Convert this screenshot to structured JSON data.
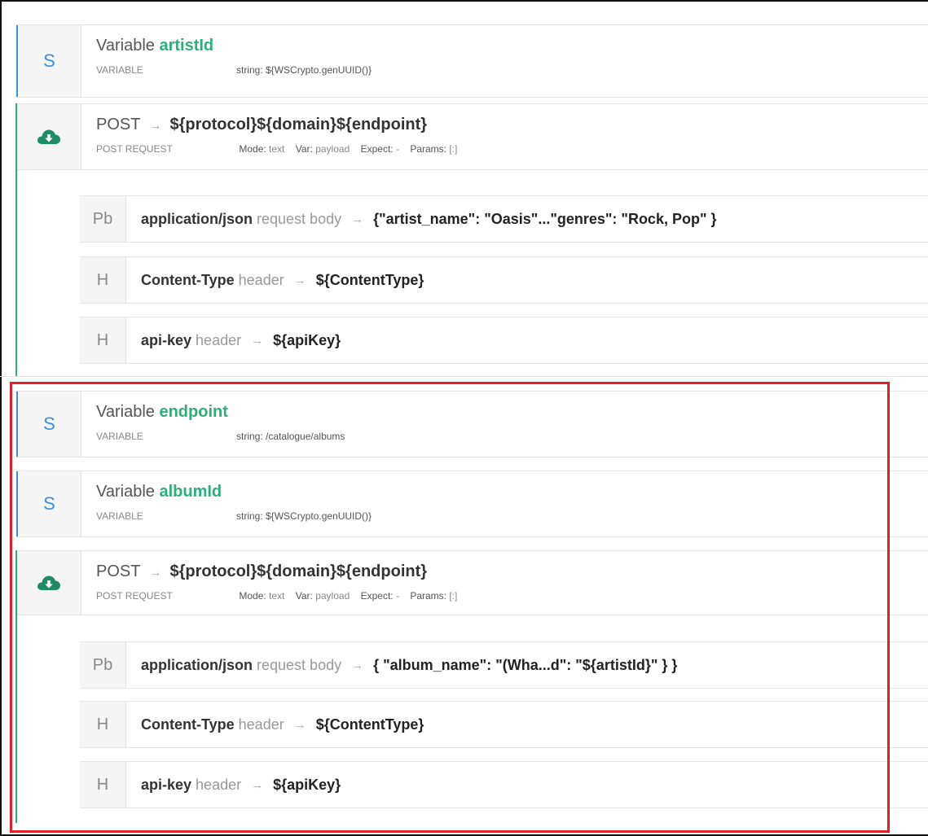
{
  "steps": [
    {
      "badge": "S",
      "title_prefix": "Variable",
      "name": "artistId",
      "kind": "VARIABLE",
      "value": "string: ${WSCrypto.genUUID()}"
    },
    {
      "method": "POST",
      "arrow": "→",
      "url": "${protocol}${domain}${endpoint}",
      "kind": "POST REQUEST",
      "mode_label": "Mode:",
      "mode_value": "text",
      "var_label": "Var:",
      "var_value": "payload",
      "expect_label": "Expect:",
      "expect_value": "-",
      "params_label": "Params:",
      "params_value": "[:]",
      "children": [
        {
          "badge": "Pb",
          "key": "application/json",
          "type": "request body",
          "arrow": "→",
          "value": "{\"artist_name\": \"Oasis\"...\"genres\": \"Rock, Pop\" }"
        },
        {
          "badge": "H",
          "key": "Content-Type",
          "type": "header",
          "arrow": "→",
          "value": "${ContentType}"
        },
        {
          "badge": "H",
          "key": "api-key",
          "type": "header",
          "arrow": "→",
          "value": "${apiKey}"
        }
      ]
    },
    {
      "badge": "S",
      "title_prefix": "Variable",
      "name": "endpoint",
      "kind": "VARIABLE",
      "value": "string: /catalogue/albums"
    },
    {
      "badge": "S",
      "title_prefix": "Variable",
      "name": "albumId",
      "kind": "VARIABLE",
      "value": "string: ${WSCrypto.genUUID()}"
    },
    {
      "method": "POST",
      "arrow": "→",
      "url": "${protocol}${domain}${endpoint}",
      "kind": "POST REQUEST",
      "mode_label": "Mode:",
      "mode_value": "text",
      "var_label": "Var:",
      "var_value": "payload",
      "expect_label": "Expect:",
      "expect_value": "-",
      "params_label": "Params:",
      "params_value": "[:]",
      "children": [
        {
          "badge": "Pb",
          "key": "application/json",
          "type": "request body",
          "arrow": "→",
          "value": "{ \"album_name\": \"(Wha...d\": \"${artistId}\" } }"
        },
        {
          "badge": "H",
          "key": "Content-Type",
          "type": "header",
          "arrow": "→",
          "value": "${ContentType}"
        },
        {
          "badge": "H",
          "key": "api-key",
          "type": "header",
          "arrow": "→",
          "value": "${apiKey}"
        }
      ]
    }
  ],
  "icons": {
    "post": "cloud-download-icon"
  },
  "colors": {
    "variable_name": "#2fae7c",
    "badge_letter": "#3d8fd6",
    "highlight": "#e0202a",
    "post_accent": "#2fae7c"
  }
}
